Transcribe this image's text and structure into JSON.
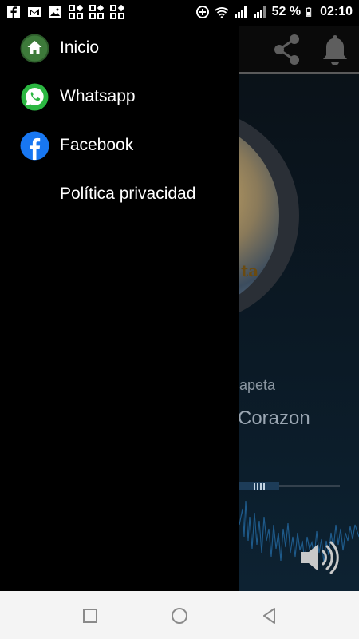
{
  "statusbar": {
    "battery": "52 %",
    "time": "02:10",
    "notification_icons": [
      "facebook-icon",
      "gmail-icon",
      "gallery-icon",
      "app-grid-icon",
      "app-grid-icon",
      "app-grid-icon"
    ],
    "system_icons": [
      "data-saver-icon",
      "wifi-icon",
      "signal-1-icon",
      "signal-2-icon",
      "battery-icon"
    ]
  },
  "drawer": {
    "items": [
      {
        "label": "Inicio",
        "icon": "home-icon"
      },
      {
        "label": "Whatsapp",
        "icon": "whatsapp-icon"
      },
      {
        "label": "Facebook",
        "icon": "facebook-icon"
      },
      {
        "label": "Política privacidad",
        "icon": ""
      }
    ]
  },
  "player": {
    "artist_partial": "apeta",
    "song_partial": "Corazon",
    "cover_text_partial": "ta",
    "progress": 0.4
  },
  "colors": {
    "home_green": "#3d7a3a",
    "whatsapp_green": "#2bb741",
    "facebook_blue": "#1877f2"
  }
}
